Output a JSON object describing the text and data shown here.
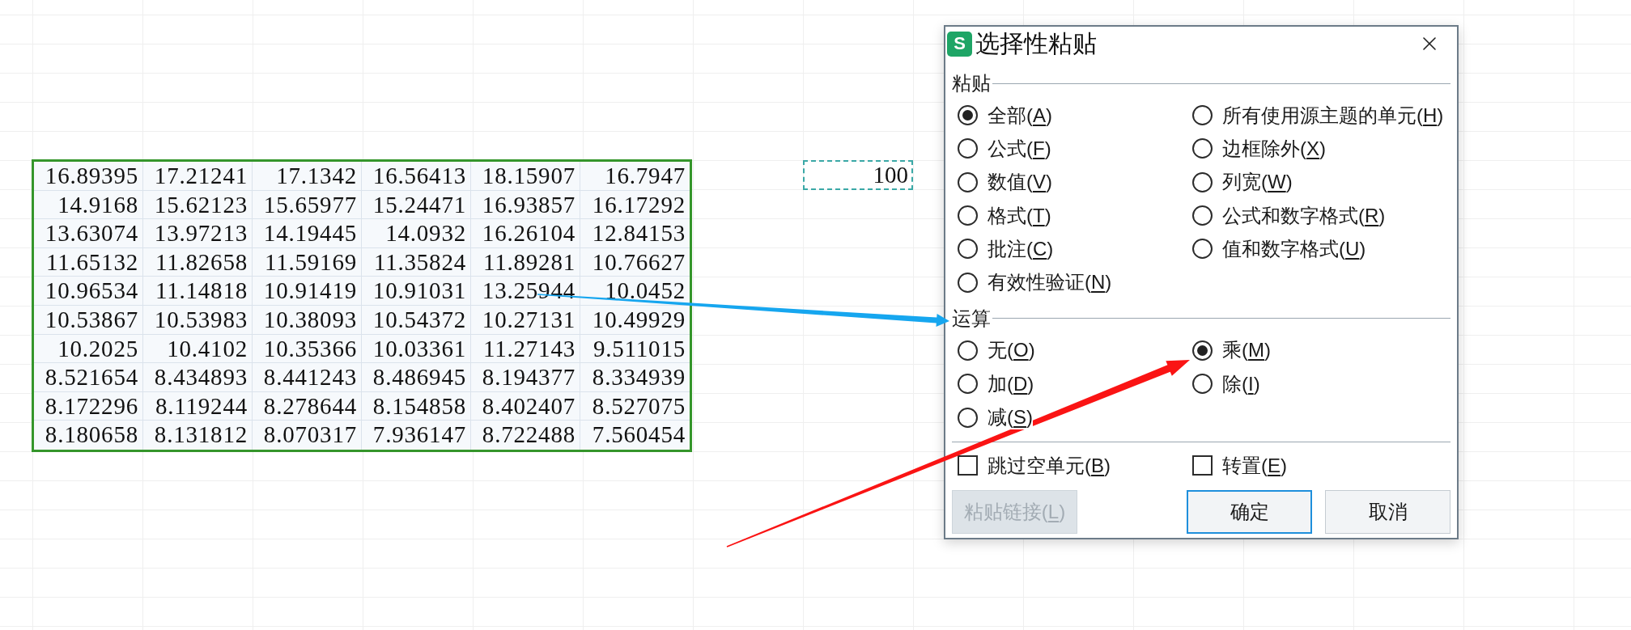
{
  "sheet": {
    "data_rows": [
      [
        "16.89395",
        "17.21241",
        "17.1342",
        "16.56413",
        "18.15907",
        "16.7947"
      ],
      [
        "14.9168",
        "15.62123",
        "15.65977",
        "15.24471",
        "16.93857",
        "16.17292"
      ],
      [
        "13.63074",
        "13.97213",
        "14.19445",
        "14.0932",
        "16.26104",
        "12.84153"
      ],
      [
        "11.65132",
        "11.82658",
        "11.59169",
        "11.35824",
        "11.89281",
        "10.76627"
      ],
      [
        "10.96534",
        "11.14818",
        "10.91419",
        "10.91031",
        "13.25944",
        "10.0452"
      ],
      [
        "10.53867",
        "10.53983",
        "10.38093",
        "10.54372",
        "10.27131",
        "10.49929"
      ],
      [
        "10.2025",
        "10.4102",
        "10.35366",
        "10.03361",
        "11.27143",
        "9.511015"
      ],
      [
        "8.521654",
        "8.434893",
        "8.441243",
        "8.486945",
        "8.194377",
        "8.334939"
      ],
      [
        "8.172296",
        "8.119244",
        "8.278644",
        "8.154858",
        "8.402407",
        "8.527075"
      ],
      [
        "8.180658",
        "8.131812",
        "8.070317",
        "7.936147",
        "8.722488",
        "7.560454"
      ]
    ],
    "copied_cell": {
      "value": "100"
    }
  },
  "dialog": {
    "app_icon": "S",
    "title": "选择性粘贴",
    "paste_section": {
      "title": "粘贴",
      "options": [
        {
          "label_parts": [
            "全部(",
            "A",
            ")"
          ],
          "selected": true
        },
        {
          "label_parts": [
            "所有使用源主题的单元(",
            "H",
            ")"
          ],
          "selected": false
        },
        {
          "label_parts": [
            "公式(",
            "F",
            ")"
          ],
          "selected": false
        },
        {
          "label_parts": [
            "边框除外(",
            "X",
            ")"
          ],
          "selected": false
        },
        {
          "label_parts": [
            "数值(",
            "V",
            ")"
          ],
          "selected": false
        },
        {
          "label_parts": [
            "列宽(",
            "W",
            ")"
          ],
          "selected": false
        },
        {
          "label_parts": [
            "格式(",
            "T",
            ")"
          ],
          "selected": false
        },
        {
          "label_parts": [
            "公式和数字格式(",
            "R",
            ")"
          ],
          "selected": false
        },
        {
          "label_parts": [
            "批注(",
            "C",
            ")"
          ],
          "selected": false
        },
        {
          "label_parts": [
            "值和数字格式(",
            "U",
            ")"
          ],
          "selected": false
        },
        {
          "label_parts": [
            "有效性验证(",
            "N",
            ")"
          ],
          "selected": false
        }
      ]
    },
    "operation_section": {
      "title": "运算",
      "options": [
        {
          "label_parts": [
            "无(",
            "O",
            ")"
          ],
          "selected": false
        },
        {
          "label_parts": [
            "乘(",
            "M",
            ")"
          ],
          "selected": true
        },
        {
          "label_parts": [
            "加(",
            "D",
            ")"
          ],
          "selected": false
        },
        {
          "label_parts": [
            "除(",
            "I",
            ")"
          ],
          "selected": false
        },
        {
          "label_parts": [
            "减(",
            "S",
            ")"
          ],
          "selected": false
        }
      ]
    },
    "checkboxes": [
      {
        "label_parts": [
          "跳过空单元(",
          "B",
          ")"
        ],
        "checked": false
      },
      {
        "label_parts": [
          "转置(",
          "E",
          ")"
        ],
        "checked": false
      }
    ],
    "buttons": [
      {
        "label_parts": [
          "粘贴链接(",
          "L",
          ")"
        ],
        "disabled": true,
        "focused": false
      },
      {
        "label_parts": [
          "确定"
        ],
        "disabled": false,
        "focused": true
      },
      {
        "label_parts": [
          "取消"
        ],
        "disabled": false,
        "focused": false
      }
    ]
  }
}
